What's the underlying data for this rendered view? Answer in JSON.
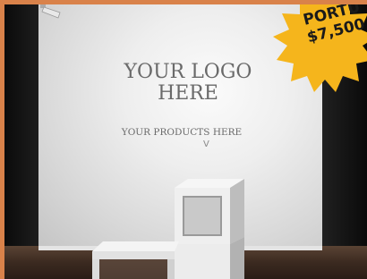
{
  "display": {
    "logo_text": "YOUR LOGO\nHERE",
    "products_text": "YOUR PRODUCTS HERE",
    "chevron": "V"
  },
  "badge": {
    "line1": "PORTU",
    "line2": "$7,500",
    "color": "#f5b51c"
  },
  "colors": {
    "frame": "#d9824a",
    "wall": "#eeeeee",
    "floor": "#3b2a20"
  }
}
